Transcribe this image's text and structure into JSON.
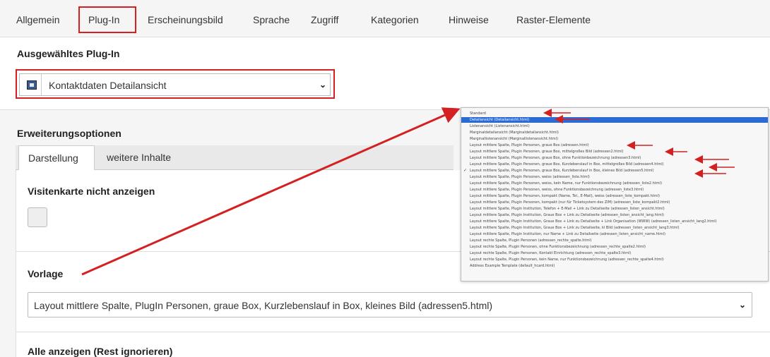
{
  "tabs": [
    {
      "label": "Allgemein"
    },
    {
      "label": "Plug-In"
    },
    {
      "label": "Erscheinungsbild"
    },
    {
      "label": "Sprache"
    },
    {
      "label": "Zugriff"
    },
    {
      "label": "Kategorien"
    },
    {
      "label": "Hinweise"
    },
    {
      "label": "Raster-Elemente"
    }
  ],
  "plugin_section": {
    "heading": "Ausgewähltes Plug-In",
    "selected_value": "Kontaktdaten Detailansicht"
  },
  "extension": {
    "heading": "Erweiterungsoptionen",
    "tabs": [
      {
        "label": "Darstellung"
      },
      {
        "label": "weitere Inhalte"
      }
    ],
    "hide_card_label": "Visitenkarte nicht anzeigen",
    "template_label": "Vorlage",
    "template_value": "Layout mittlere Spalte, PlugIn Personen, graue Box, Kurzlebenslauf in Box, kleines Bild (adressen5.html)",
    "show_all_label": "Alle anzeigen (Rest ignorieren)"
  },
  "template_options": [
    "Standard",
    "Detailansicht (Detailansicht.html)",
    "Listenansicht (Listenansicht.html)",
    "Marginaldetailansicht (Marginaldetailansicht.html)",
    "Marginallistenansicht (Marginallistenansicht.html)",
    "Layout mittlere Spalte, Plugin Personen, graue Box (adressen.html)",
    "Layout mittlere Spalte, Plugin Personen, graue Box, mittelgroßes Bild (adressen2.html)",
    "Layout mittlere Spalte, Plugin Personen, graue Box, ohne Funktionbezeichnung (adressen3.html)",
    "Layout mittlere Spalte, Plugin Personen, graue Box, Kurzlebenslauf in Box, mittelgroßes Bild (adressen4.html)",
    "Layout mittlere Spalte, Plugin Personen, graue Box, Kurzlebenslauf in Box, kleines Bild (adressen5.html)",
    "Layout mittlere Spalte, Plugin Personen, weiss (adressen_liste.html)",
    "Layout mittlere Spalte, Plugin Personen, weiss, kein Name, nur Funktionsbezeichnung (adressen_liste2.html)",
    "Layout mittlere Spalte, Plugin Personen, weiss, ohne Funktionsbezeichnung (adressen_liste3.html)",
    "Layout mittlere Spalte, Plugin Personen, kompakt (Name, Tel., E-Mail), weiss (adressen_liste_kompakt.html)",
    "Layout mittlere Spalte, Plugin Personen, kompakt (nur für Ticketsystem des ZIM) (adressen_liste_kompakt2.html)",
    "Layout mittlere Spalte, Plugin Institution, Telefon + E-Mail + Link zu Detailseite (adressen_listen_ansicht.html)",
    "Layout mittlere Spalte, Plugin Institution, Graue Box + Link zu Detailseite (adressen_listen_ansicht_lang.html)",
    "Layout mittlere Spalte, Plugin Institution, Graue Box + Link zu Detailseite + Link Organisation (WWW) (adressen_listen_ansicht_lang2.html)",
    "Layout mittlere Spalte, Plugin Institution, Graue Box + Link zu Detailseite, kl Bild (adressen_listen_ansicht_lang3.html)",
    "Layout mittlere Spalte, Plugin Institution, nur Name + Link zu Detailseite (adressen_listen_ansicht_name.html)",
    "Layout rechte Spalte, Plugin Personen (adressen_rechte_spalte.html)",
    "Layout rechte Spalte, Plugin Personen, ohne Funktionsbezeichnung (adressen_rechte_spalte2.html)",
    "Layout rechte Spalte, Plugin Personen, Kontakt Einrichtung (adressen_rechte_spalte3.html)",
    "Layout rechte Spalte, Plugin Personen, kein Name, nur Funktionsbezeichnung (adressen_rechte_spalte4.html)",
    "Address Example Template (default_hcard.html)"
  ],
  "colors": {
    "highlight_red": "#d42020",
    "selected_blue": "#2a6bd6"
  },
  "icons": {
    "plugin": "plugin-contact-icon",
    "dropdown": "chevron-down-icon",
    "checkmark": "checkmark-icon"
  }
}
